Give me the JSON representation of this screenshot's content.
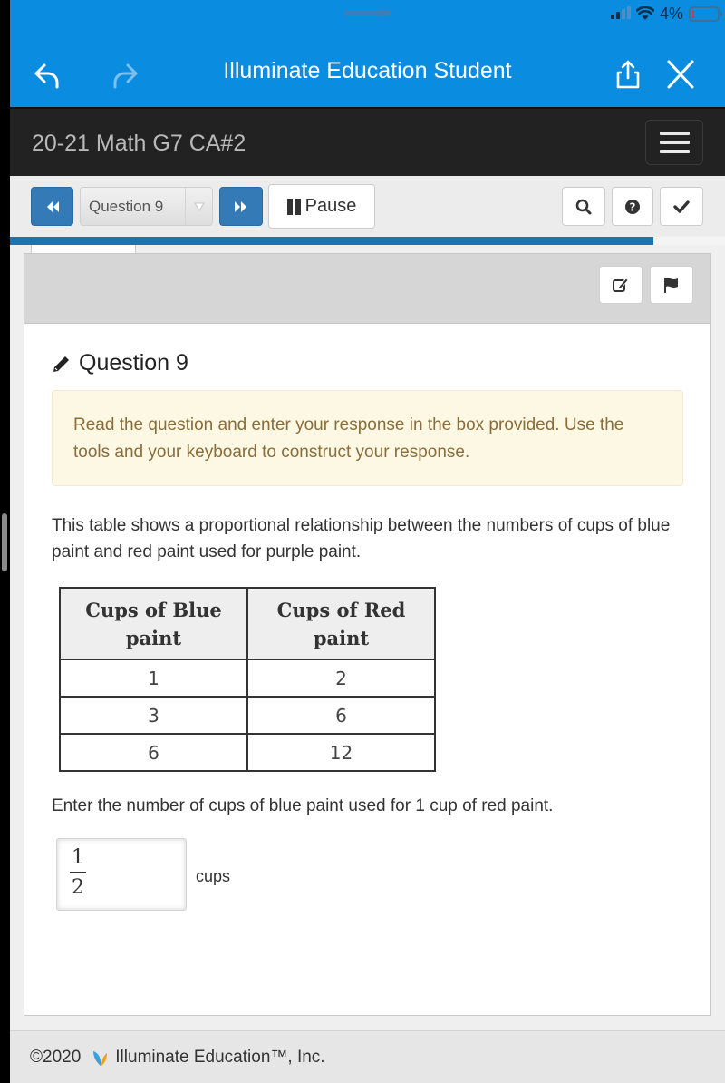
{
  "status_bar": {
    "battery_text": "4%",
    "icons": [
      "signal-icon",
      "wifi-icon",
      "battery-icon"
    ]
  },
  "browser": {
    "title": "Illuminate Education Student",
    "back_icon": "back-arrow-icon",
    "forward_icon": "forward-arrow-icon",
    "share_icon": "share-icon",
    "close_icon": "close-icon"
  },
  "header": {
    "course_title": "20-21 Math G7 CA#2",
    "menu_icon": "hamburger-menu-icon"
  },
  "toolbar": {
    "prev_icon": "double-left-icon",
    "question_select": "Question 9",
    "next_icon": "double-right-icon",
    "pause_label": "Pause",
    "search_icon": "search-icon",
    "help_icon": "question-circle-icon",
    "submit_icon": "checkmark-icon",
    "progress_percent": 90
  },
  "panel": {
    "tools": [
      "notepad-icon",
      "flag-icon"
    ],
    "question_title": "Question 9",
    "instructions": "Read the question and enter your response in the box provided. Use the tools and your keyboard to construct your response.",
    "prompt": "This table shows a proportional relationship between the numbers of cups of blue paint and red paint used for purple paint.",
    "table": {
      "headers": [
        "Cups of Blue paint",
        "Cups of Red paint"
      ],
      "rows": [
        [
          "1",
          "2"
        ],
        [
          "3",
          "6"
        ],
        [
          "6",
          "12"
        ]
      ]
    },
    "question": "Enter the number of cups of blue paint used for 1 cup of red paint.",
    "answer": {
      "numerator": "1",
      "denominator": "2"
    },
    "unit": "cups"
  },
  "footer": {
    "year": "©2020",
    "company": "Illuminate Education™, Inc."
  },
  "colors": {
    "browser_bar": "#0a8ce0",
    "nav_blue": "#337ab7",
    "progress": "#1a75b2",
    "alert_bg": "#fcf8e3",
    "alert_text": "#8a6d3b"
  }
}
